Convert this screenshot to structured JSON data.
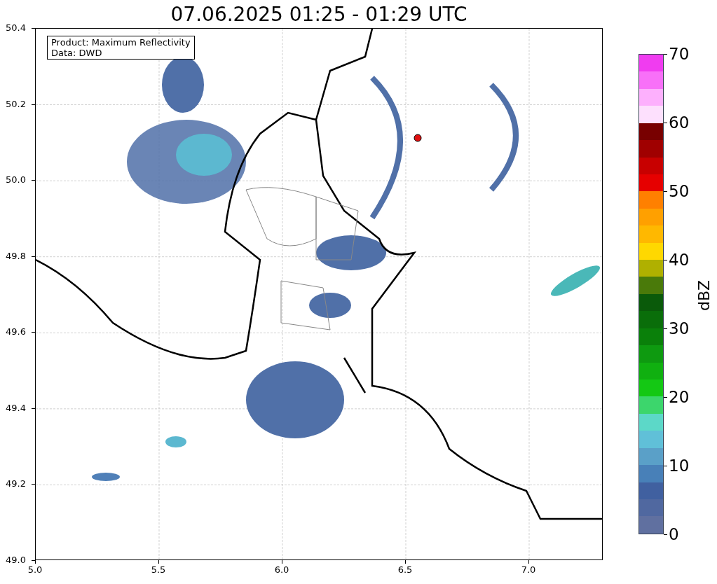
{
  "title": "07.06.2025 01:25 - 01:29 UTC",
  "legend": {
    "lines": [
      "Product: Maximum Reflectivity",
      "Data: DWD"
    ]
  },
  "x_axis": {
    "ticks": [
      "5.0",
      "5.5",
      "6.0",
      "6.5",
      "7.0"
    ]
  },
  "y_axis": {
    "ticks": [
      "50.4",
      "50.2",
      "50.0",
      "49.8",
      "49.6",
      "49.4",
      "49.2",
      "49.0"
    ]
  },
  "colorbar": {
    "label": "dBZ",
    "ticks": [
      "70",
      "60",
      "50",
      "40",
      "30",
      "20",
      "10",
      "0"
    ],
    "segments": [
      {
        "color": "#f03cf0"
      },
      {
        "color": "#f870f8"
      },
      {
        "color": "#fdb0fd"
      },
      {
        "color": "#fde0fd"
      },
      {
        "color": "#780000"
      },
      {
        "color": "#a00000"
      },
      {
        "color": "#c80000"
      },
      {
        "color": "#e60000"
      },
      {
        "color": "#ff8000"
      },
      {
        "color": "#ffa000"
      },
      {
        "color": "#ffb800"
      },
      {
        "color": "#ffd800"
      },
      {
        "color": "#b0b000"
      },
      {
        "color": "#4a7a0a"
      },
      {
        "color": "#0a5a0a"
      },
      {
        "color": "#0a6e0a"
      },
      {
        "color": "#0a800a"
      },
      {
        "color": "#0e9a10"
      },
      {
        "color": "#10b010"
      },
      {
        "color": "#14c814"
      },
      {
        "color": "#3cd66c"
      },
      {
        "color": "#5cd8c8"
      },
      {
        "color": "#60c0d8"
      },
      {
        "color": "#5aa0c8"
      },
      {
        "color": "#4880b8"
      },
      {
        "color": "#4060a0"
      },
      {
        "color": "#5068a0"
      },
      {
        "color": "#6070a0"
      }
    ]
  }
}
